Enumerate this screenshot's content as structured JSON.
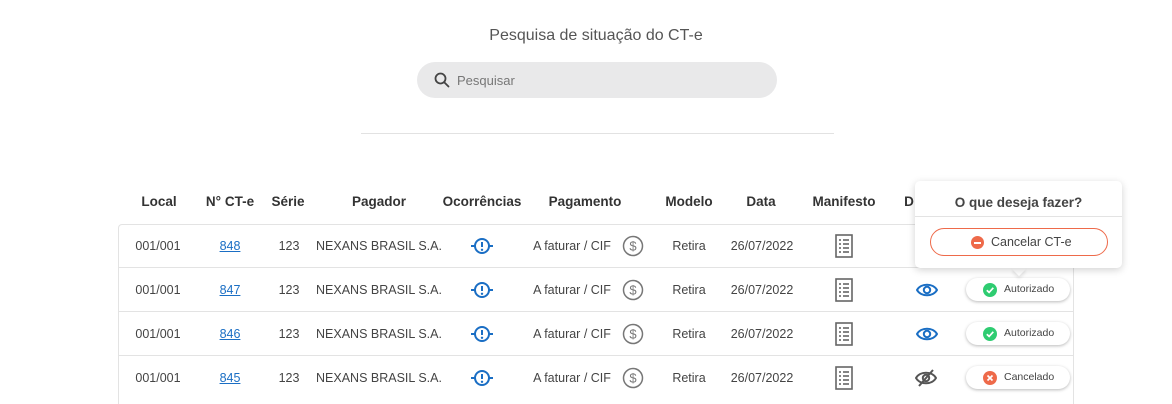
{
  "page": {
    "title": "Pesquisa de situação do CT-e"
  },
  "search": {
    "placeholder": "Pesquisar",
    "value": ""
  },
  "table": {
    "headers": {
      "local": "Local",
      "numero": "N° CT-e",
      "serie": "Série",
      "pagador": "Pagador",
      "ocorrencias": "Ocorrências",
      "pagamento": "Pagamento",
      "modelo": "Modelo",
      "data": "Data",
      "manifesto": "Manifesto",
      "d": "D"
    },
    "rows": [
      {
        "local": "001/001",
        "numero": "848",
        "serie": "123",
        "pagador": "NEXANS BRASIL S.A.",
        "pagamento": "A faturar / CIF",
        "modelo": "Retira",
        "data": "26/07/2022",
        "visibility": "eye-icon",
        "status": "",
        "status_type": ""
      },
      {
        "local": "001/001",
        "numero": "847",
        "serie": "123",
        "pagador": "NEXANS BRASIL S.A.",
        "pagamento": "A faturar / CIF",
        "modelo": "Retira",
        "data": "26/07/2022",
        "visibility": "eye-icon",
        "status": "Autorizado",
        "status_type": "ok"
      },
      {
        "local": "001/001",
        "numero": "846",
        "serie": "123",
        "pagador": "NEXANS BRASIL S.A.",
        "pagamento": "A faturar / CIF",
        "modelo": "Retira",
        "data": "26/07/2022",
        "visibility": "eye-icon",
        "status": "Autorizado",
        "status_type": "ok"
      },
      {
        "local": "001/001",
        "numero": "845",
        "serie": "123",
        "pagador": "NEXANS BRASIL S.A.",
        "pagamento": "A faturar / CIF",
        "modelo": "Retira",
        "data": "26/07/2022",
        "visibility": "eye-slash-icon",
        "status": "Cancelado",
        "status_type": "cancel"
      }
    ]
  },
  "popover": {
    "title": "O que deseja fazer?",
    "action_label": "Cancelar CT-e"
  },
  "colors": {
    "link": "#1a6ec4",
    "ok": "#2ecc71",
    "cancel": "#ee6a4a",
    "search_bg": "#e9e9ea"
  }
}
